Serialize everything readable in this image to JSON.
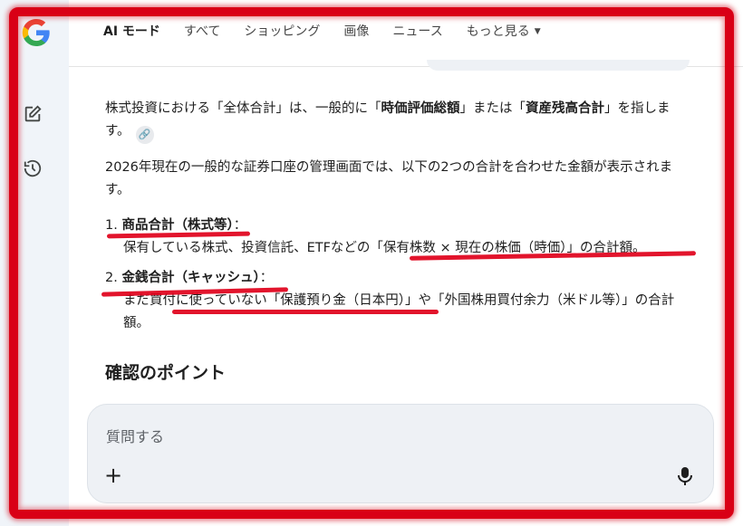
{
  "nav": {
    "tabs": [
      {
        "label": "AI モード",
        "active": true
      },
      {
        "label": "すべて"
      },
      {
        "label": "ショッピング"
      },
      {
        "label": "画像"
      },
      {
        "label": "ニュース"
      },
      {
        "label": "もっと見る",
        "has_dropdown": true
      }
    ]
  },
  "sidebar": {
    "icons": [
      "google-logo",
      "new-chat-icon",
      "history-icon"
    ]
  },
  "answer": {
    "p1": {
      "t1": "株式投資における「全体合計」は、一般的に「",
      "b1": "時価評価総額",
      "t2": "」または「",
      "b2": "資産残高合計",
      "t3": "」を指します。"
    },
    "p2": "2026年現在の一般的な証券口座の管理画面では、以下の2つの合計を合わせた金額が表示されます。",
    "items": [
      {
        "num": "1.",
        "title": "商品合計（株式等）",
        "colon": "：",
        "desc": "保有している株式、投資信託、ETFなどの「保有株数 × 現在の株価（時価）」の合計額。"
      },
      {
        "num": "2.",
        "title": "金銭合計（キャッシュ）",
        "colon": "：",
        "desc": "まだ買付に使っていない「保護預り金（日本円）」や「外国株用買付余力（米ドル等）」の合計額。"
      }
    ],
    "section_title": "確認のポイント"
  },
  "composer": {
    "placeholder": "質問する",
    "plus": "+"
  },
  "colors": {
    "annotation_red": "#d90016",
    "sidebar_bg": "#f0f4f9"
  }
}
